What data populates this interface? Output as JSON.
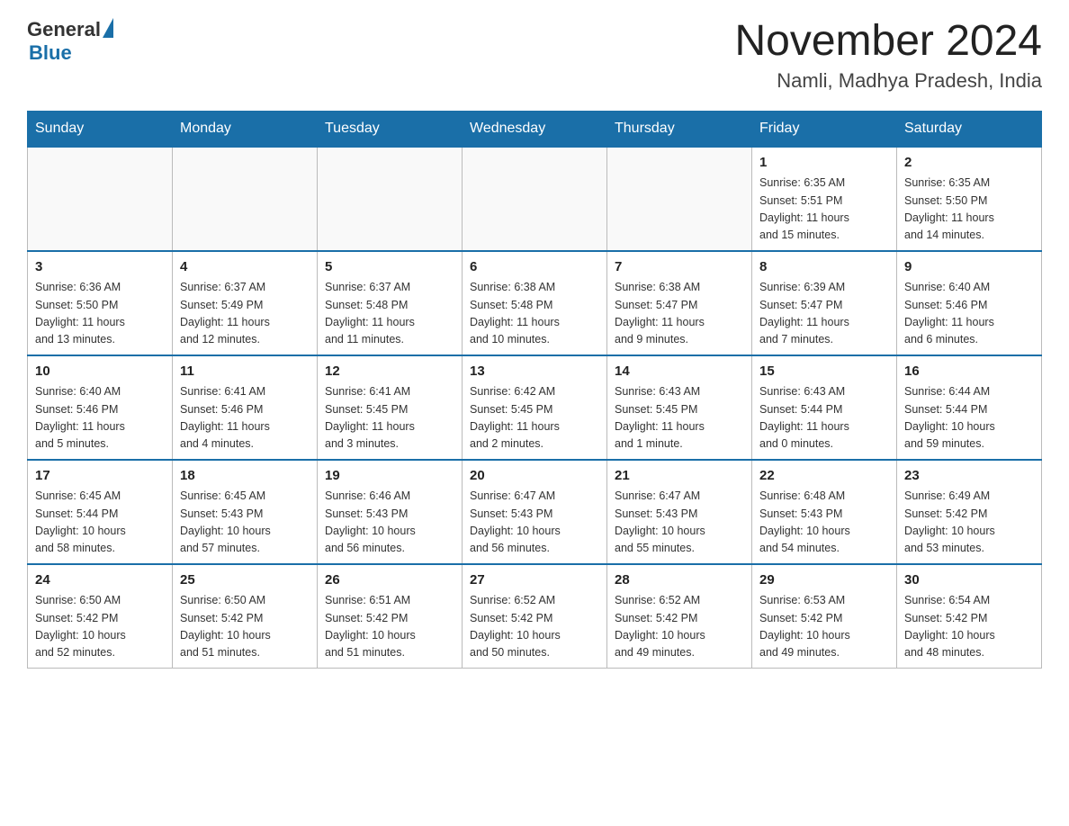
{
  "header": {
    "logo_general": "General",
    "logo_blue": "Blue",
    "month_title": "November 2024",
    "location": "Namli, Madhya Pradesh, India"
  },
  "weekdays": [
    "Sunday",
    "Monday",
    "Tuesday",
    "Wednesday",
    "Thursday",
    "Friday",
    "Saturday"
  ],
  "weeks": [
    {
      "days": [
        {
          "num": "",
          "info": ""
        },
        {
          "num": "",
          "info": ""
        },
        {
          "num": "",
          "info": ""
        },
        {
          "num": "",
          "info": ""
        },
        {
          "num": "",
          "info": ""
        },
        {
          "num": "1",
          "info": "Sunrise: 6:35 AM\nSunset: 5:51 PM\nDaylight: 11 hours\nand 15 minutes."
        },
        {
          "num": "2",
          "info": "Sunrise: 6:35 AM\nSunset: 5:50 PM\nDaylight: 11 hours\nand 14 minutes."
        }
      ]
    },
    {
      "days": [
        {
          "num": "3",
          "info": "Sunrise: 6:36 AM\nSunset: 5:50 PM\nDaylight: 11 hours\nand 13 minutes."
        },
        {
          "num": "4",
          "info": "Sunrise: 6:37 AM\nSunset: 5:49 PM\nDaylight: 11 hours\nand 12 minutes."
        },
        {
          "num": "5",
          "info": "Sunrise: 6:37 AM\nSunset: 5:48 PM\nDaylight: 11 hours\nand 11 minutes."
        },
        {
          "num": "6",
          "info": "Sunrise: 6:38 AM\nSunset: 5:48 PM\nDaylight: 11 hours\nand 10 minutes."
        },
        {
          "num": "7",
          "info": "Sunrise: 6:38 AM\nSunset: 5:47 PM\nDaylight: 11 hours\nand 9 minutes."
        },
        {
          "num": "8",
          "info": "Sunrise: 6:39 AM\nSunset: 5:47 PM\nDaylight: 11 hours\nand 7 minutes."
        },
        {
          "num": "9",
          "info": "Sunrise: 6:40 AM\nSunset: 5:46 PM\nDaylight: 11 hours\nand 6 minutes."
        }
      ]
    },
    {
      "days": [
        {
          "num": "10",
          "info": "Sunrise: 6:40 AM\nSunset: 5:46 PM\nDaylight: 11 hours\nand 5 minutes."
        },
        {
          "num": "11",
          "info": "Sunrise: 6:41 AM\nSunset: 5:46 PM\nDaylight: 11 hours\nand 4 minutes."
        },
        {
          "num": "12",
          "info": "Sunrise: 6:41 AM\nSunset: 5:45 PM\nDaylight: 11 hours\nand 3 minutes."
        },
        {
          "num": "13",
          "info": "Sunrise: 6:42 AM\nSunset: 5:45 PM\nDaylight: 11 hours\nand 2 minutes."
        },
        {
          "num": "14",
          "info": "Sunrise: 6:43 AM\nSunset: 5:45 PM\nDaylight: 11 hours\nand 1 minute."
        },
        {
          "num": "15",
          "info": "Sunrise: 6:43 AM\nSunset: 5:44 PM\nDaylight: 11 hours\nand 0 minutes."
        },
        {
          "num": "16",
          "info": "Sunrise: 6:44 AM\nSunset: 5:44 PM\nDaylight: 10 hours\nand 59 minutes."
        }
      ]
    },
    {
      "days": [
        {
          "num": "17",
          "info": "Sunrise: 6:45 AM\nSunset: 5:44 PM\nDaylight: 10 hours\nand 58 minutes."
        },
        {
          "num": "18",
          "info": "Sunrise: 6:45 AM\nSunset: 5:43 PM\nDaylight: 10 hours\nand 57 minutes."
        },
        {
          "num": "19",
          "info": "Sunrise: 6:46 AM\nSunset: 5:43 PM\nDaylight: 10 hours\nand 56 minutes."
        },
        {
          "num": "20",
          "info": "Sunrise: 6:47 AM\nSunset: 5:43 PM\nDaylight: 10 hours\nand 56 minutes."
        },
        {
          "num": "21",
          "info": "Sunrise: 6:47 AM\nSunset: 5:43 PM\nDaylight: 10 hours\nand 55 minutes."
        },
        {
          "num": "22",
          "info": "Sunrise: 6:48 AM\nSunset: 5:43 PM\nDaylight: 10 hours\nand 54 minutes."
        },
        {
          "num": "23",
          "info": "Sunrise: 6:49 AM\nSunset: 5:42 PM\nDaylight: 10 hours\nand 53 minutes."
        }
      ]
    },
    {
      "days": [
        {
          "num": "24",
          "info": "Sunrise: 6:50 AM\nSunset: 5:42 PM\nDaylight: 10 hours\nand 52 minutes."
        },
        {
          "num": "25",
          "info": "Sunrise: 6:50 AM\nSunset: 5:42 PM\nDaylight: 10 hours\nand 51 minutes."
        },
        {
          "num": "26",
          "info": "Sunrise: 6:51 AM\nSunset: 5:42 PM\nDaylight: 10 hours\nand 51 minutes."
        },
        {
          "num": "27",
          "info": "Sunrise: 6:52 AM\nSunset: 5:42 PM\nDaylight: 10 hours\nand 50 minutes."
        },
        {
          "num": "28",
          "info": "Sunrise: 6:52 AM\nSunset: 5:42 PM\nDaylight: 10 hours\nand 49 minutes."
        },
        {
          "num": "29",
          "info": "Sunrise: 6:53 AM\nSunset: 5:42 PM\nDaylight: 10 hours\nand 49 minutes."
        },
        {
          "num": "30",
          "info": "Sunrise: 6:54 AM\nSunset: 5:42 PM\nDaylight: 10 hours\nand 48 minutes."
        }
      ]
    }
  ]
}
